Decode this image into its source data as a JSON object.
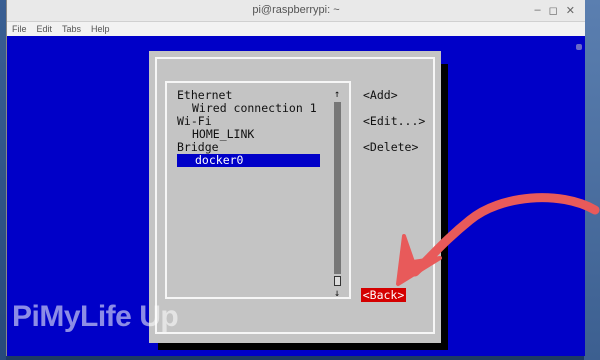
{
  "window": {
    "title": "pi@raspberrypi: ~",
    "controls": [
      "–",
      "◻",
      "✕"
    ]
  },
  "menu": [
    "File",
    "Edit",
    "Tabs",
    "Help"
  ],
  "dialog": {
    "list": [
      {
        "label": "Ethernet",
        "indent": 0
      },
      {
        "label": "Wired connection 1",
        "indent": 1
      },
      {
        "label": "Wi-Fi",
        "indent": 0
      },
      {
        "label": "HOME_LINK",
        "indent": 1
      },
      {
        "label": "Bridge",
        "indent": 0
      }
    ],
    "selected_item": "docker0",
    "scroll_up": "↑",
    "scroll_down": "↓",
    "buttons": {
      "add": "<Add>",
      "edit": "<Edit...>",
      "delete": "<Delete>",
      "back": "<Back>"
    }
  },
  "watermark": {
    "text": "PiMyLife Up"
  },
  "annotation": {
    "arrow_color": "#e85a5a",
    "target": "back-button"
  }
}
